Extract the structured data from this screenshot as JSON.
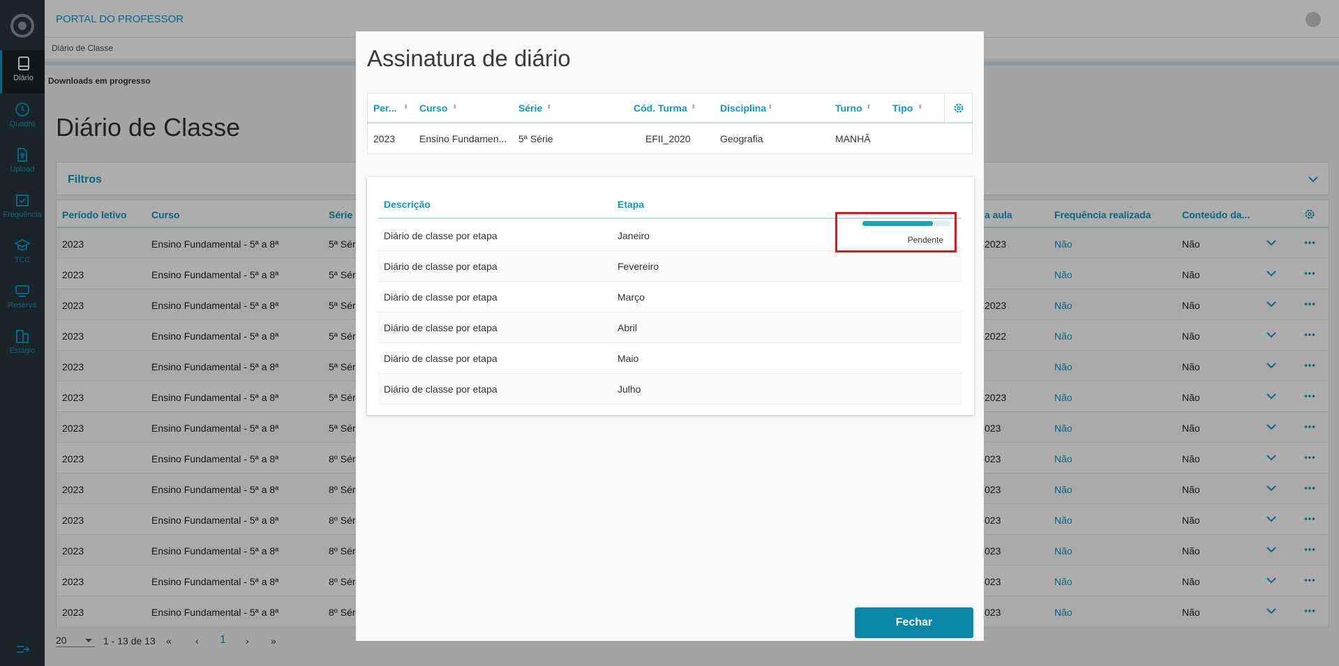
{
  "app": {
    "title": "PORTAL DO PROFESSOR"
  },
  "sidebar": {
    "items": [
      {
        "label": "Diário",
        "icon": "book-icon",
        "active": true
      },
      {
        "label": "Quadro",
        "icon": "clock-icon"
      },
      {
        "label": "Upload",
        "icon": "upload-icon"
      },
      {
        "label": "Frequência",
        "icon": "calendar-check-icon"
      },
      {
        "label": "TCC",
        "icon": "graduation-cap-icon"
      },
      {
        "label": "Reserva",
        "icon": "monitor-icon"
      },
      {
        "label": "Estágio",
        "icon": "building-icon"
      }
    ]
  },
  "breadcrumb": "Diário de Classe",
  "downloads": "Downloads em progresso",
  "page": {
    "title": "Diário de Classe"
  },
  "filters": {
    "label": "Filtros"
  },
  "background_table": {
    "headers": [
      "Período letivo",
      "Curso",
      "Série",
      "a aula",
      "Frequência realizada",
      "Conteúdo da..."
    ],
    "rows": [
      {
        "periodo": "2023",
        "curso": "Ensino Fundamental - 5ª a 8ª",
        "serie": "5ª Séri",
        "aula": "2023",
        "freq": "Não",
        "conteudo": "Não"
      },
      {
        "periodo": "2023",
        "curso": "Ensino Fundamental - 5ª a 8ª",
        "serie": "5ª Séri",
        "aula": "",
        "freq": "Não",
        "conteudo": "Não"
      },
      {
        "periodo": "2023",
        "curso": "Ensino Fundamental - 5ª a 8ª",
        "serie": "5ª Séri",
        "aula": "2023",
        "freq": "Não",
        "conteudo": "Não"
      },
      {
        "periodo": "2023",
        "curso": "Ensino Fundamental - 5ª a 8ª",
        "serie": "5ª Séri",
        "aula": "2022",
        "freq": "Não",
        "conteudo": "Não"
      },
      {
        "periodo": "2023",
        "curso": "Ensino Fundamental - 5ª a 8ª",
        "serie": "5ª Séri",
        "aula": "",
        "freq": "Não",
        "conteudo": "Não"
      },
      {
        "periodo": "2023",
        "curso": "Ensino Fundamental - 5ª a 8ª",
        "serie": "5ª Séri",
        "aula": "2023",
        "freq": "Não",
        "conteudo": "Não"
      },
      {
        "periodo": "2023",
        "curso": "Ensino Fundamental - 5ª a 8ª",
        "serie": "5ª Séri",
        "aula": "023",
        "freq": "Não",
        "conteudo": "Não"
      },
      {
        "periodo": "2023",
        "curso": "Ensino Fundamental - 5ª a 8ª",
        "serie": "8º Séri",
        "aula": "023",
        "freq": "Não",
        "conteudo": "Não"
      },
      {
        "periodo": "2023",
        "curso": "Ensino Fundamental - 5ª a 8ª",
        "serie": "8º Séri",
        "aula": "023",
        "freq": "Não",
        "conteudo": "Não"
      },
      {
        "periodo": "2023",
        "curso": "Ensino Fundamental - 5ª a 8ª",
        "serie": "8º Séri",
        "aula": "023",
        "freq": "Não",
        "conteudo": "Não"
      },
      {
        "periodo": "2023",
        "curso": "Ensino Fundamental - 5ª a 8ª",
        "serie": "8º Séri",
        "aula": "023",
        "freq": "Não",
        "conteudo": "Não"
      },
      {
        "periodo": "2023",
        "curso": "Ensino Fundamental - 5ª a 8ª",
        "serie": "8º Séri",
        "aula": "023",
        "freq": "Não",
        "conteudo": "Não"
      },
      {
        "periodo": "2023",
        "curso": "Ensino Fundamental - 5ª a 8ª",
        "serie": "8º Séri",
        "aula": "023",
        "freq": "Não",
        "conteudo": "Não"
      }
    ]
  },
  "pagination": {
    "page_size": "20",
    "range": "1 - 13 de 13",
    "first": "«",
    "prev": "‹",
    "current": "1",
    "next": "›",
    "last": "»"
  },
  "modal": {
    "title": "Assinatura de diário",
    "class_table": {
      "headers": [
        "Per...",
        "Curso",
        "Série",
        "Cód. Turma",
        "Disciplina",
        "Turno",
        "Tipo"
      ],
      "row": {
        "periodo": "2023",
        "curso": "Ensino Fundamen...",
        "serie": "5ª Série",
        "cod_turma": "EFII_2020",
        "disciplina": "Geografia",
        "turno": "MANHÃ",
        "tipo": ""
      }
    },
    "detail": {
      "headers": [
        "Descrição",
        "Etapa"
      ],
      "rows": [
        {
          "descricao": "Diário de classe por etapa",
          "etapa": "Janeiro"
        },
        {
          "descricao": "Diário de classe por etapa",
          "etapa": "Fevereiro"
        },
        {
          "descricao": "Diário de classe por etapa",
          "etapa": "Março"
        },
        {
          "descricao": "Diário de classe por etapa",
          "etapa": "Abril"
        },
        {
          "descricao": "Diário de classe por etapa",
          "etapa": "Maio"
        },
        {
          "descricao": "Diário de classe por etapa",
          "etapa": "Julho"
        }
      ],
      "status": {
        "label": "Pendente",
        "progress": 0.8
      }
    },
    "close_label": "Fechar"
  },
  "colors": {
    "accent": "#0c9abe",
    "sidebar": "#29363b",
    "button": "#0c87a8",
    "highlight": "#e0151d"
  }
}
